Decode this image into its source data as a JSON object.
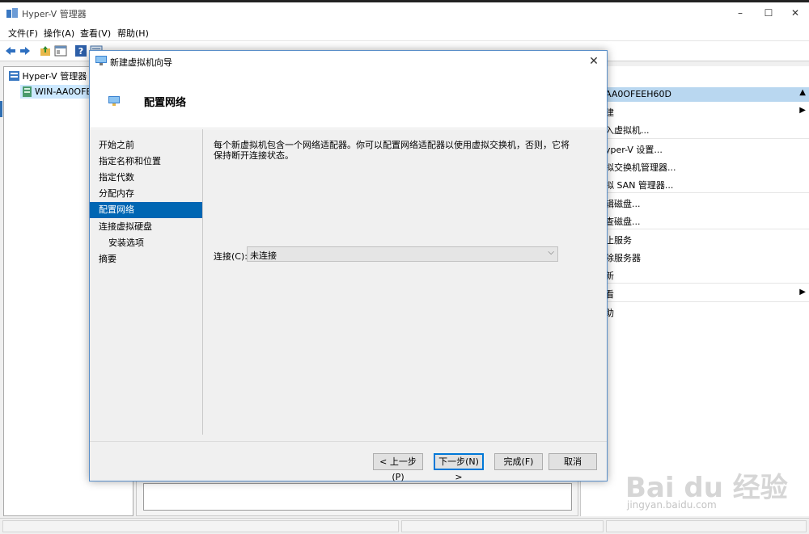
{
  "window": {
    "title": "Hyper-V 管理器",
    "minimize": "–",
    "maximize": "☐",
    "close": "✕"
  },
  "menu": [
    "文件(F)",
    "操作(A)",
    "查看(V)",
    "帮助(H)"
  ],
  "tree": {
    "root": "Hyper-V 管理器",
    "server": "WIN-AA0OFEEH60D"
  },
  "actions": {
    "header": "AA0OFEEH60D",
    "items": [
      {
        "label": "建",
        "submenu": true
      },
      {
        "label": "入虚拟机...",
        "submenu": false
      },
      {
        "label": "yper-V 设置...",
        "submenu": false
      },
      {
        "label": "拟交换机管理器...",
        "submenu": false
      },
      {
        "label": "拟 SAN 管理器...",
        "submenu": false
      },
      {
        "label": "辑磁盘...",
        "submenu": false
      },
      {
        "label": "查磁盘...",
        "submenu": false
      },
      {
        "label": "止服务",
        "submenu": false
      },
      {
        "label": "除服务器",
        "submenu": false
      },
      {
        "label": "新",
        "submenu": false
      },
      {
        "label": "看",
        "submenu": true
      },
      {
        "label": "助",
        "submenu": false
      }
    ]
  },
  "dialog": {
    "title": "新建虚拟机向导",
    "page_title": "配置网络",
    "steps": [
      {
        "label": "开始之前",
        "sub": false,
        "active": false
      },
      {
        "label": "指定名称和位置",
        "sub": false,
        "active": false
      },
      {
        "label": "指定代数",
        "sub": false,
        "active": false
      },
      {
        "label": "分配内存",
        "sub": false,
        "active": false
      },
      {
        "label": "配置网络",
        "sub": false,
        "active": true
      },
      {
        "label": "连接虚拟硬盘",
        "sub": false,
        "active": false
      },
      {
        "label": "安装选项",
        "sub": true,
        "active": false
      },
      {
        "label": "摘要",
        "sub": false,
        "active": false
      }
    ],
    "description": "每个新虚拟机包含一个网络适配器。你可以配置网络适配器以使用虚拟交换机，否则，它将保持断开连接状态。",
    "connection_label": "连接(C):",
    "connection_value": "未连接",
    "buttons": {
      "prev": "< 上一步(P)",
      "next": "下一步(N) >",
      "finish": "完成(F)",
      "cancel": "取消"
    }
  },
  "watermark": {
    "brand": "Bai du 经验",
    "url": "jingyan.baidu.com"
  }
}
